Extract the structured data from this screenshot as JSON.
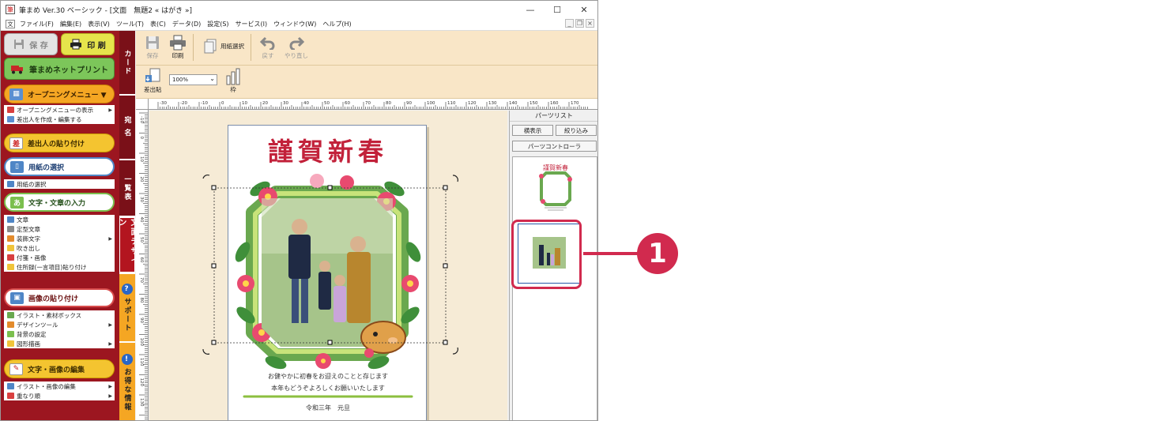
{
  "window": {
    "title": "筆まめ Ver.30 ベーシック - [文面　無題2 « はがき »]",
    "controls": [
      "—",
      "☐",
      "✕"
    ],
    "mdi_controls": [
      "_",
      "❐",
      "×"
    ]
  },
  "menubar": {
    "items": [
      "ファイル(F)",
      "編集(E)",
      "表示(V)",
      "ツール(T)",
      "表(C)",
      "データ(D)",
      "設定(S)",
      "サービス(I)",
      "ウィンドウ(W)",
      "ヘルプ(H)"
    ]
  },
  "sidebar": {
    "save_label": "保 存",
    "print_label": "印 刷",
    "netprint_label": "筆まめネットプリント",
    "opening_label": "オープニングメニュー ▼",
    "opening_items": [
      "オープニングメニューの表示",
      "差出人を作成・編集する"
    ],
    "sender_label": "差出人の貼り付け",
    "paper_label": "用紙の選択",
    "paper_items": [
      "用紙の選択"
    ],
    "text_label": "文字・文章の入力",
    "text_items": [
      "文章",
      "定型文章",
      "装飾文字",
      "吹き出し",
      "付箋・画像",
      "住所録(一言項目)貼り付け"
    ],
    "image_label": "画像の貼り付け",
    "image_items": [
      "イラスト・素材ボックス",
      "デザインツール",
      "背景の設定",
      "図形描画"
    ],
    "edit_label": "文字・画像の編集",
    "edit_items": [
      "イラスト・画像の編集",
      "重なり順"
    ]
  },
  "vtabs": {
    "card": "カード",
    "atena": "宛 名",
    "ichiran": "一覧表",
    "design": "文面デザイン",
    "support": "サポート",
    "info": "お得な情報"
  },
  "toolbar": {
    "save": "保存",
    "print": "印刷",
    "paper_select": "用紙選択",
    "undo": "戻す",
    "redo": "やり直し",
    "sender_paste": "差出貼",
    "zoom": "100%",
    "frame": "枠"
  },
  "ruler": {
    "h_labels": [
      "-30",
      "-20",
      "-10",
      "0",
      "10",
      "20",
      "30",
      "40",
      "50",
      "60",
      "70",
      "80",
      "90",
      "100",
      "110",
      "120",
      "130",
      "140",
      "150",
      "160",
      "170"
    ],
    "v_labels": [
      "-10",
      "0",
      "10",
      "20",
      "30",
      "40",
      "50",
      "60",
      "70",
      "80",
      "90",
      "100",
      "110",
      "120",
      "130",
      "140"
    ]
  },
  "card": {
    "heading": "謹賀新春",
    "line1": "お健やかに初春をお迎えのことと存じます",
    "line2": "本年もどうぞよろしくお願いいたします",
    "date": "令和三年　元旦"
  },
  "parts_panel": {
    "title": "パーツリスト",
    "btn_horizontal": "横表示",
    "btn_filter": "絞り込み",
    "btn_controller": "パーツコントローラ",
    "thumb1_heading": "謹賀新春"
  },
  "callout": {
    "number": "1"
  },
  "colors": {
    "sidebar_bg": "#9c1620",
    "toolbar_bg": "#f9e6c7",
    "canvas_bg": "#f6ebd6",
    "highlight": "#d12a4e",
    "heading_red": "#c2213a"
  }
}
